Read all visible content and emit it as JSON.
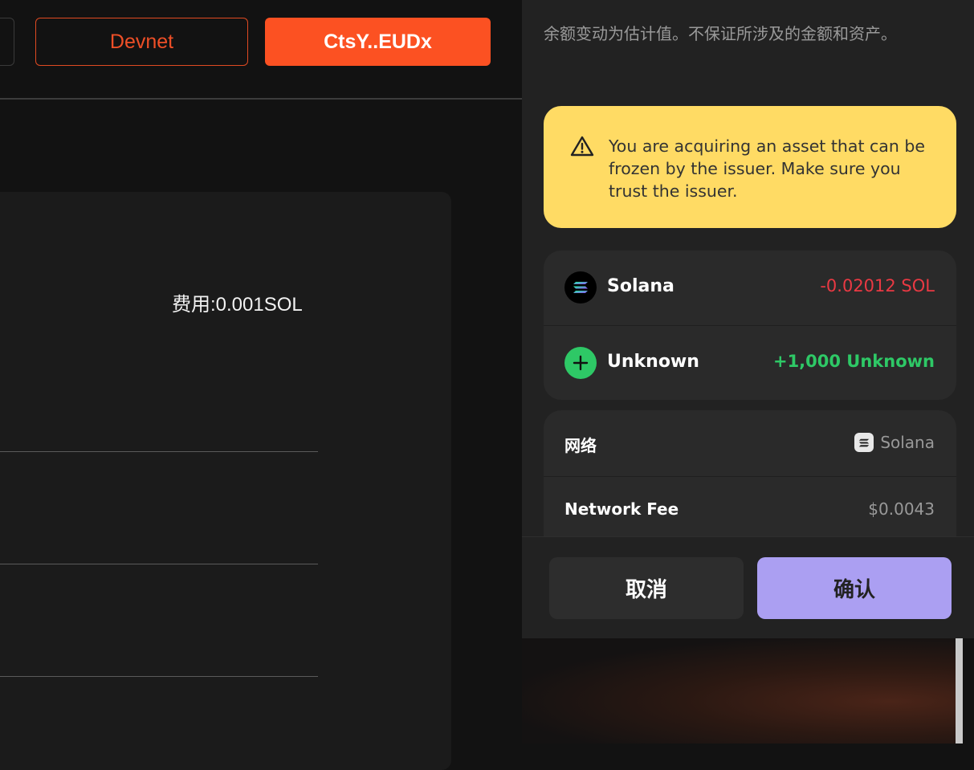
{
  "app": {
    "network_button": "Devnet",
    "wallet_button": "CtsY..EUDx",
    "fee_text": "费用:0.001SOL"
  },
  "wallet": {
    "disclaimer": "余额变动为估计值。不保证所涉及的金额和资产。",
    "warning": {
      "icon": "warning-triangle-icon",
      "text": "You are acquiring an asset that can be frozen by the issuer. Make sure you trust the issuer."
    },
    "balance_changes": [
      {
        "icon": "solana-icon",
        "name": "Solana",
        "amount": "-0.02012 SOL",
        "color": "#ea3943"
      },
      {
        "icon": "plus-icon",
        "name": "Unknown",
        "amount": "+1,000 Unknown",
        "color": "#2ec866"
      }
    ],
    "details": [
      {
        "label": "网络",
        "value": "Solana",
        "icon": "solana-icon"
      },
      {
        "label": "Network Fee",
        "value": "$0.0043"
      }
    ],
    "cancel_button": "取消",
    "confirm_button": "确认"
  },
  "colors": {
    "accent_orange": "#fc5122",
    "warning_yellow": "#ffdb64",
    "confirm_purple": "#ab9ff2"
  }
}
